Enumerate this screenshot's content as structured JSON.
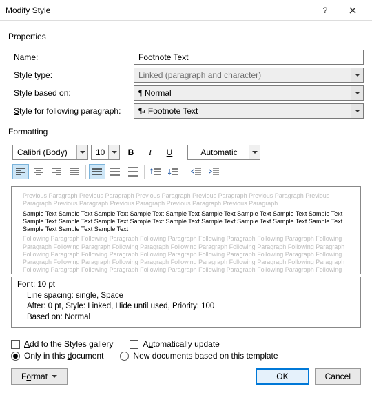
{
  "window": {
    "title": "Modify Style"
  },
  "properties": {
    "legend": "Properties",
    "name_label_pre": "",
    "name_key": "N",
    "name_label_post": "ame:",
    "name_value": "Footnote Text",
    "type_label_pre": "Style ",
    "type_key": "t",
    "type_label_post": "ype:",
    "type_value": "Linked (paragraph and character)",
    "based_label_pre": "Style ",
    "based_key": "b",
    "based_label_post": "ased on:",
    "based_value": "Normal",
    "following_label_pre": "",
    "following_key": "S",
    "following_label_post": "tyle for following paragraph:",
    "following_value": "Footnote Text"
  },
  "formatting": {
    "legend": "Formatting",
    "font": "Calibri (Body)",
    "size": "10",
    "bold": "B",
    "italic": "I",
    "underline": "U",
    "color": "Automatic"
  },
  "preview": {
    "prev": "Previous Paragraph Previous Paragraph Previous Paragraph Previous Paragraph Previous Paragraph Previous Paragraph Previous Paragraph Previous Paragraph Previous Paragraph Previous Paragraph",
    "sample": "Sample Text Sample Text Sample Text Sample Text Sample Text Sample Text Sample Text Sample Text Sample Text Sample Text Sample Text Sample Text Sample Text Sample Text Sample Text Sample Text Sample Text Sample Text Sample Text Sample Text Sample Text",
    "foll": "Following Paragraph Following Paragraph Following Paragraph Following Paragraph Following Paragraph Following Paragraph Following Paragraph Following Paragraph Following Paragraph Following Paragraph Following Paragraph Following Paragraph Following Paragraph Following Paragraph Following Paragraph Following Paragraph Following Paragraph Following Paragraph Following Paragraph Following Paragraph Following Paragraph Following Paragraph Following Paragraph Following Paragraph Following Paragraph Following Paragraph Following Paragraph Following Paragraph Following Paragraph"
  },
  "description": {
    "line1": "Font: 10 pt",
    "line2": "Line spacing:  single, Space",
    "line3": "After:  0 pt, Style: Linked, Hide until used, Priority: 100",
    "line4": "Based on: Normal"
  },
  "options": {
    "add_pre": "",
    "add_key": "A",
    "add_post": "dd to the Styles gallery",
    "auto_pre": "A",
    "auto_key": "u",
    "auto_post": "tomatically update",
    "only_pre": "Only in this ",
    "only_key": "d",
    "only_post": "ocument",
    "newdoc": "New documents based on this template"
  },
  "buttons": {
    "format_pre": "F",
    "format_key": "o",
    "format_post": "rmat",
    "ok": "OK",
    "cancel": "Cancel"
  }
}
